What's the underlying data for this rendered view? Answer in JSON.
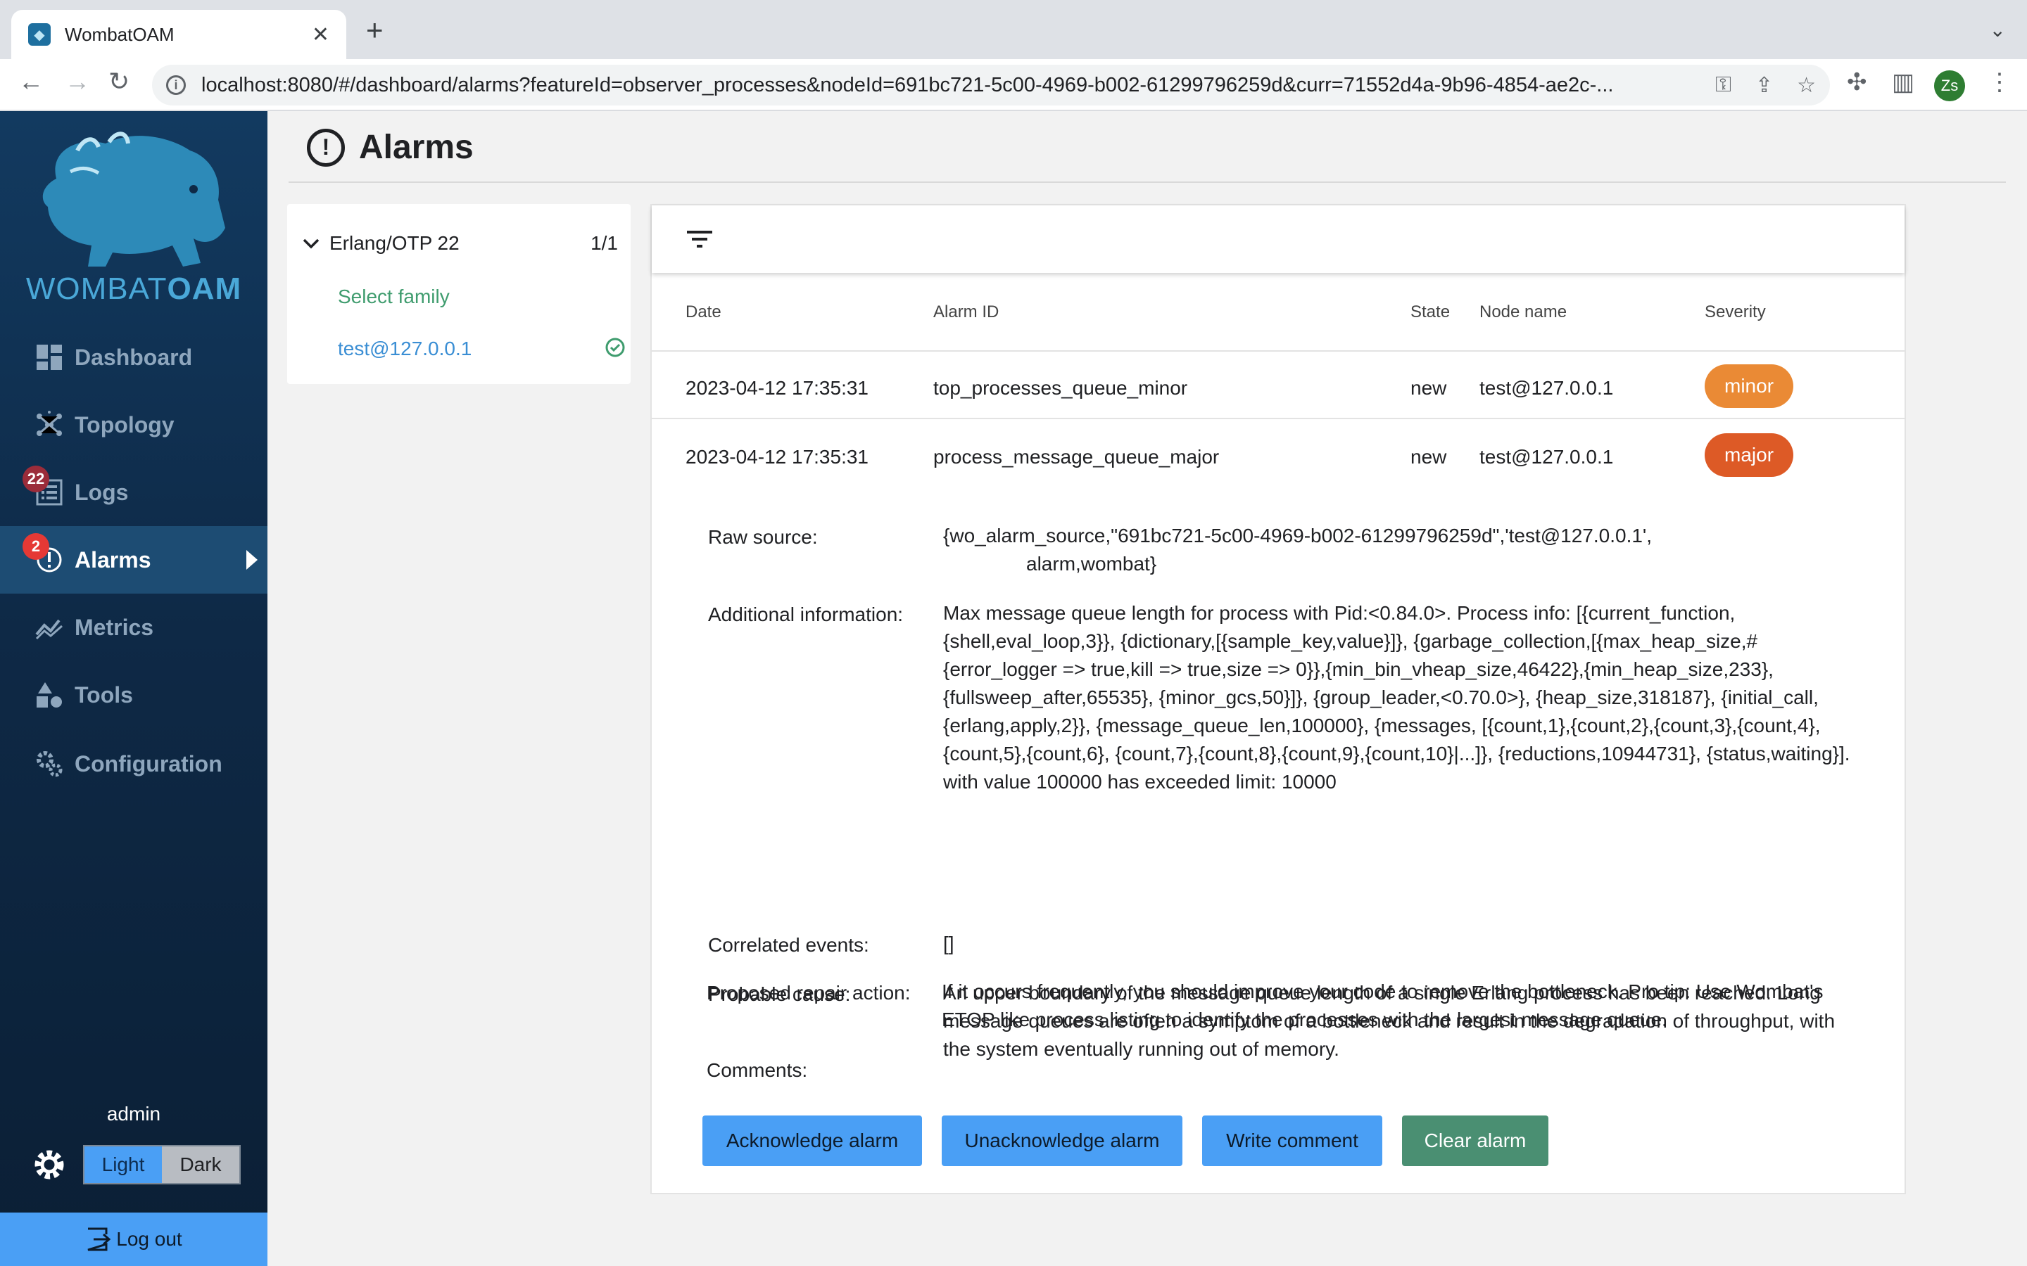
{
  "browser": {
    "tab_title": "WombatOAM",
    "url": "localhost:8080/#/dashboard/alarms?featureId=observer_processes&nodeId=691bc721-5c00-4969-b002-61299796259d&curr=71552d4a-9b96-4854-ae2c-...",
    "avatar_initials": "Zs"
  },
  "sidebar": {
    "logo_text_light": "WOMBAT",
    "logo_text_bold": "OAM",
    "items": [
      {
        "label": "Dashboard",
        "icon": "dashboard-icon"
      },
      {
        "label": "Topology",
        "icon": "topology-icon"
      },
      {
        "label": "Logs",
        "icon": "logs-icon",
        "badge": "22"
      },
      {
        "label": "Alarms",
        "icon": "alarm-icon",
        "badge": "2",
        "active": true
      },
      {
        "label": "Metrics",
        "icon": "metrics-icon"
      },
      {
        "label": "Tools",
        "icon": "tools-icon"
      },
      {
        "label": "Configuration",
        "icon": "configuration-icon"
      }
    ],
    "user": "admin",
    "theme_light": "Light",
    "theme_dark": "Dark",
    "logout": "Log out",
    "colors": {
      "logs_badge": "#9b2c3a",
      "alarms_badge": "#e53935",
      "toggle_active": "#4a9ff5"
    }
  },
  "page": {
    "title": "Alarms"
  },
  "tree": {
    "family": "Erlang/OTP 22",
    "count": "1/1",
    "select_family": "Select family",
    "node": "test@127.0.0.1"
  },
  "table": {
    "headers": {
      "date": "Date",
      "alarm_id": "Alarm ID",
      "state": "State",
      "node": "Node name",
      "severity": "Severity"
    },
    "rows": [
      {
        "date": "2023-04-12 17:35:31",
        "alarm_id": "top_processes_queue_minor",
        "state": "new",
        "node": "test@127.0.0.1",
        "severity": "minor",
        "severity_color": "#ea8a35"
      },
      {
        "date": "2023-04-12 17:35:31",
        "alarm_id": "process_message_queue_major",
        "state": "new",
        "node": "test@127.0.0.1",
        "severity": "major",
        "severity_color": "#dd5a26"
      }
    ]
  },
  "details": {
    "raw_source_label": "Raw source:",
    "raw_source_line1": "{wo_alarm_source,\"691bc721-5c00-4969-b002-61299796259d\",'test@127.0.0.1',",
    "raw_source_line2": "alarm,wombat}",
    "additional_label": "Additional information:",
    "additional_value": "Max message queue length for  process with Pid:<0.84.0>. Process info: [{current_function, {shell,eval_loop,3}}, {dictionary,[{sample_key,value}]}, {garbage_collection,[{max_heap_size,#{error_logger => true,kill => true,size => 0}},{min_bin_vheap_size,46422},{min_heap_size,233},{fullsweep_after,65535}, {minor_gcs,50}]}, {group_leader,<0.70.0>}, {heap_size,318187}, {initial_call,{erlang,apply,2}}, {message_queue_len,100000}, {messages, [{count,1},{count,2},{count,3},{count,4},{count,5},{count,6}, {count,7},{count,8},{count,9},{count,10}|...]}, {reductions,10944731}, {status,waiting}]. with value 100000 has exceeded limit: 10000",
    "correlated_label": "Correlated events:",
    "correlated_value": "[]",
    "cause_label": "Probable cause:",
    "cause_value": "An upper boundary of the message queue length of a single Erlang process has been reached. Long message queues are often a symptom of a bottleneck and result in the degradation of throughput, with the system eventually running out of memory.",
    "repair_label": "Proposed repair action:",
    "repair_value": "If it occurs frequently, you should improve your code to remove the bottleneck. Pro tip: Use Wombat's ETOP like process listing to identify the processes with the largest message queue.",
    "comments_label": "Comments:"
  },
  "actions": {
    "acknowledge": "Acknowledge alarm",
    "unacknowledge": "Unacknowledge alarm",
    "write_comment": "Write comment",
    "clear": "Clear alarm",
    "colors": {
      "primary": "#4a9ff5",
      "clear": "#4a8f72"
    }
  }
}
